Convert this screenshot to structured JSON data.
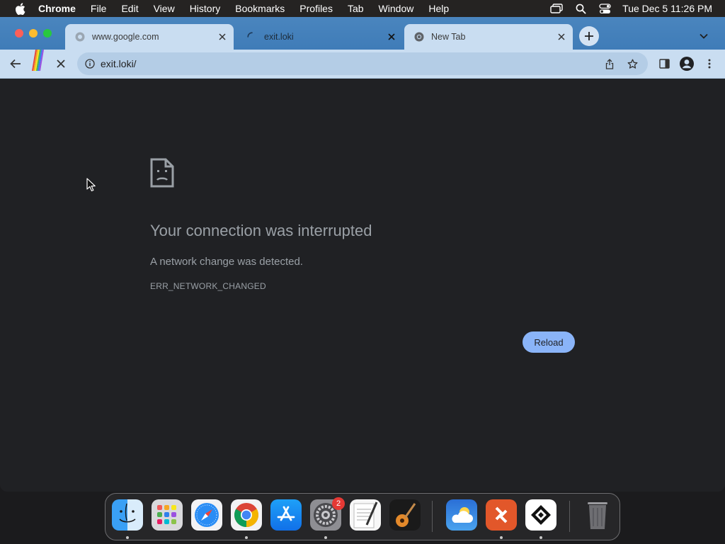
{
  "menubar": {
    "app_name": "Chrome",
    "items": [
      "File",
      "Edit",
      "View",
      "History",
      "Bookmarks",
      "Profiles",
      "Tab",
      "Window",
      "Help"
    ],
    "clock": "Tue Dec 5  11:26 PM"
  },
  "tabs": [
    {
      "title": "www.google.com",
      "icon": "globe-icon",
      "active": false
    },
    {
      "title": "exit.loki",
      "icon": "loading-spinner-icon",
      "active": true
    },
    {
      "title": "New Tab",
      "icon": "chrome-icon",
      "active": false
    }
  ],
  "toolbar": {
    "url": "exit.loki/"
  },
  "error_page": {
    "title": "Your connection was interrupted",
    "description": "A network change was detected.",
    "code": "ERR_NETWORK_CHANGED",
    "reload_label": "Reload"
  },
  "dock": {
    "apps": [
      {
        "name": "Finder",
        "running": true
      },
      {
        "name": "Launchpad",
        "running": false
      },
      {
        "name": "Safari",
        "running": false
      },
      {
        "name": "Chrome",
        "running": true
      },
      {
        "name": "App Store",
        "running": false
      },
      {
        "name": "System Settings",
        "running": true,
        "badge": "2"
      },
      {
        "name": "TextEdit",
        "running": false
      },
      {
        "name": "GarageBand",
        "running": false
      },
      {
        "name": "Weather",
        "running": false
      },
      {
        "name": "Remote Desktop",
        "running": true
      },
      {
        "name": "Network App",
        "running": true
      },
      {
        "name": "Trash",
        "running": false
      }
    ]
  },
  "colors": {
    "accent": "#8ab4f8",
    "page_background": "#202124",
    "tabstrip": "#3f7cb8",
    "toolbar": "#c9ddf1"
  }
}
